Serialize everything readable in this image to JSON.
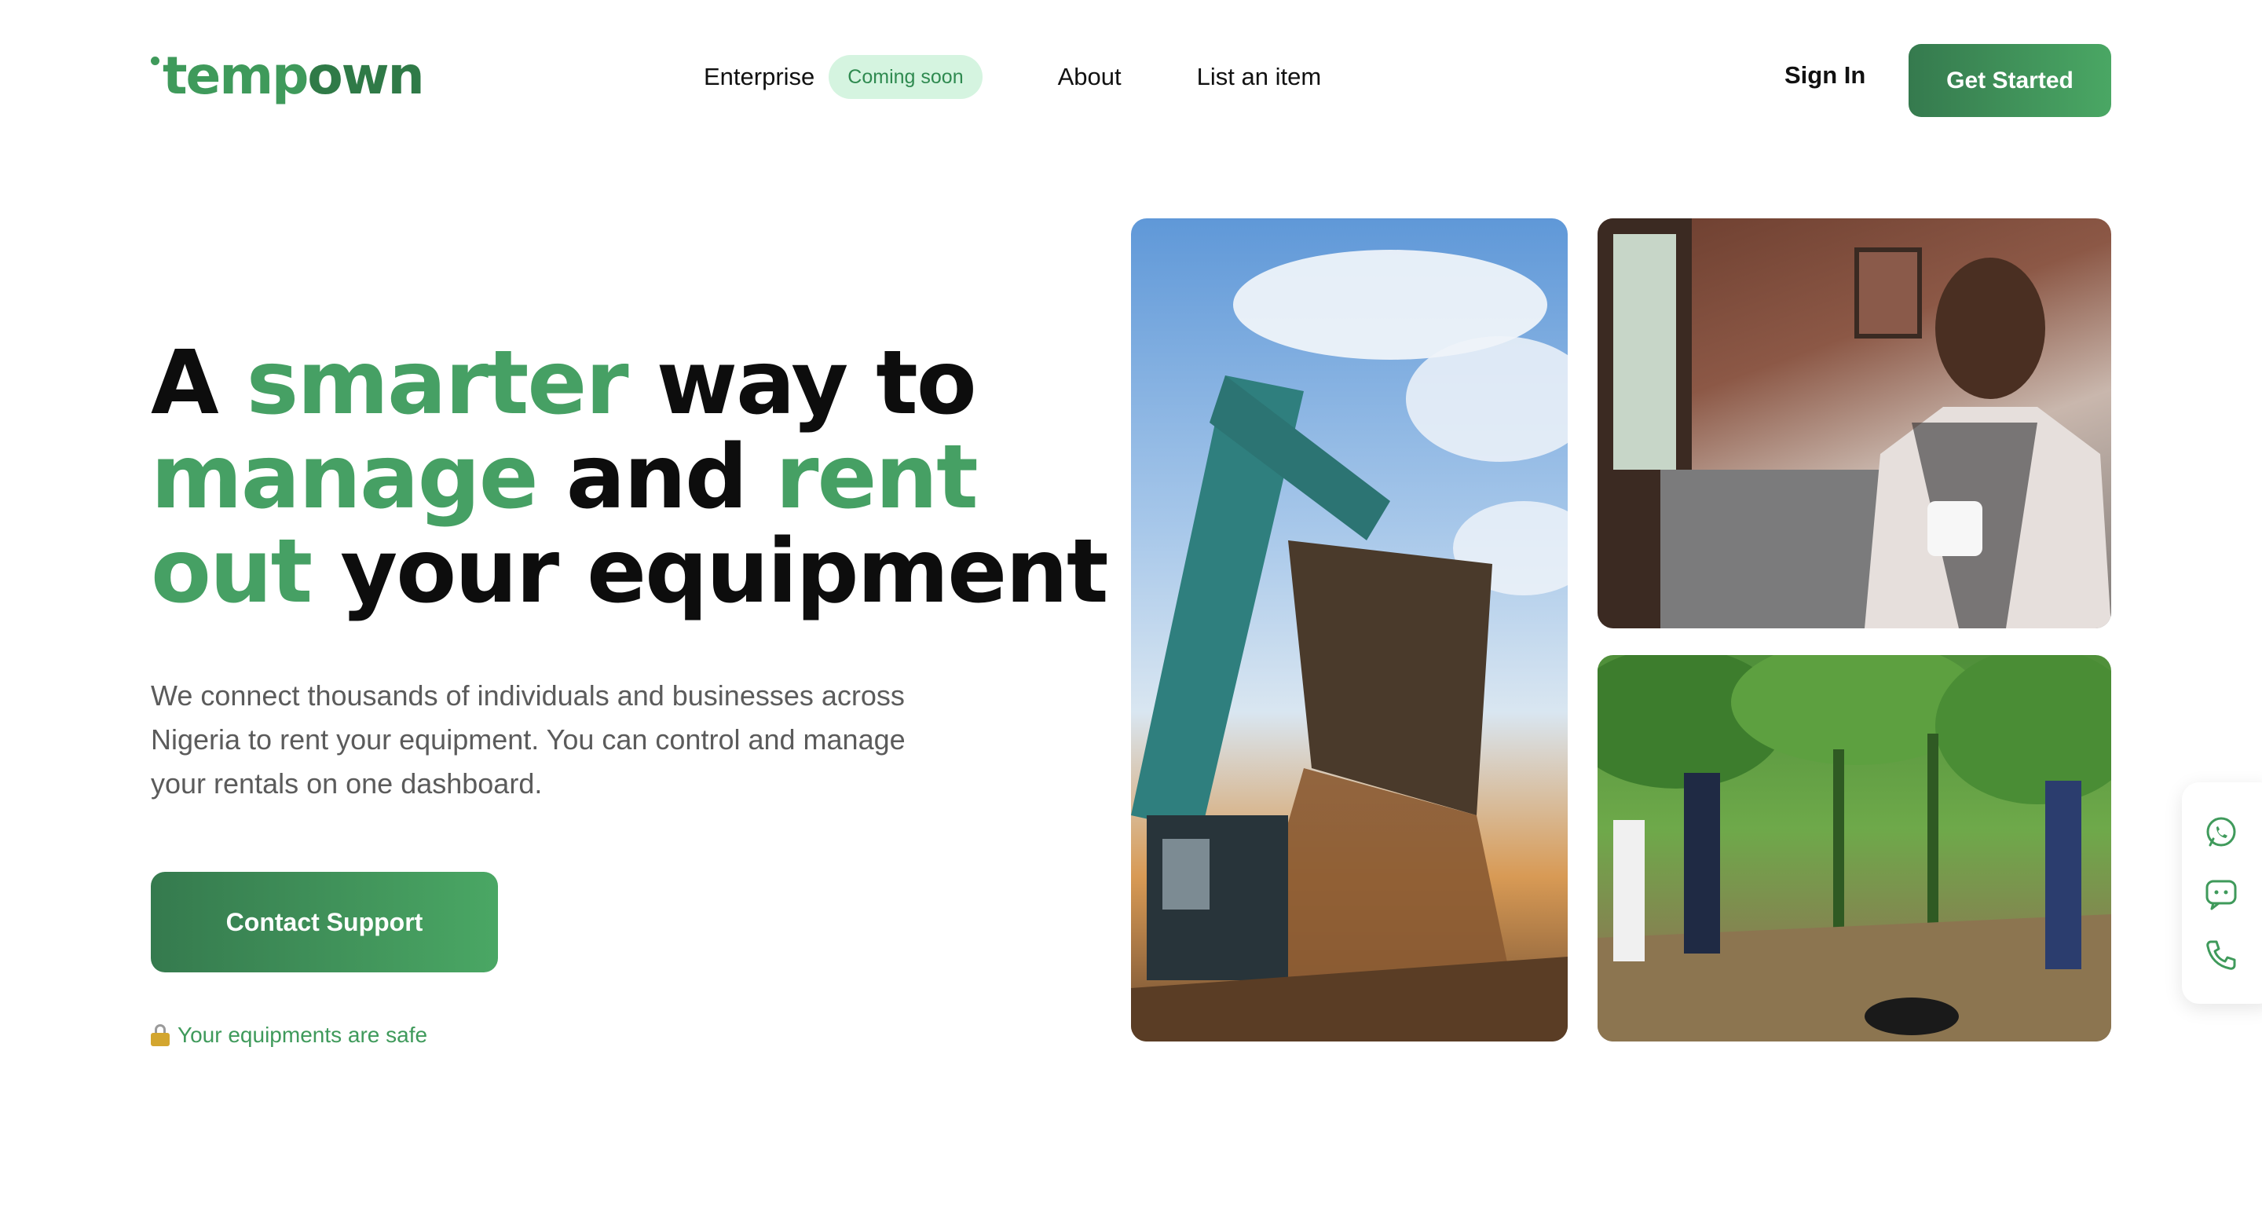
{
  "header": {
    "logo": {
      "prefix": "temp",
      "suffix": "own"
    },
    "nav": {
      "enterprise": "Enterprise",
      "enterprise_badge": "Coming soon",
      "about": "About",
      "list_item": "List an item"
    },
    "sign_in": "Sign In",
    "get_started": "Get Started"
  },
  "hero": {
    "title": {
      "w1": "A ",
      "w2": "smarter",
      "w3": " way to ",
      "w4": "manage",
      "w5": " and ",
      "w6": "rent out",
      "w7": " your equipment"
    },
    "description": "We connect thousands of individuals and businesses across Nigeria to rent your equipment. You can control and manage your rentals on one dashboard.",
    "contact_button": "Contact Support",
    "safe_note": "Your equipments are safe"
  },
  "images": {
    "excavator": "excavator-photo",
    "man": "man-with-coffee-photo",
    "field": "film-crew-in-plantation-photo"
  },
  "floating_widget": {
    "icons": [
      "whatsapp-icon",
      "chat-icon",
      "phone-icon"
    ]
  },
  "colors": {
    "brand_green": "#3f9a5b",
    "button_dark": "#357a4e",
    "button_light": "#4aa764",
    "badge_bg": "#d5f4e0"
  }
}
